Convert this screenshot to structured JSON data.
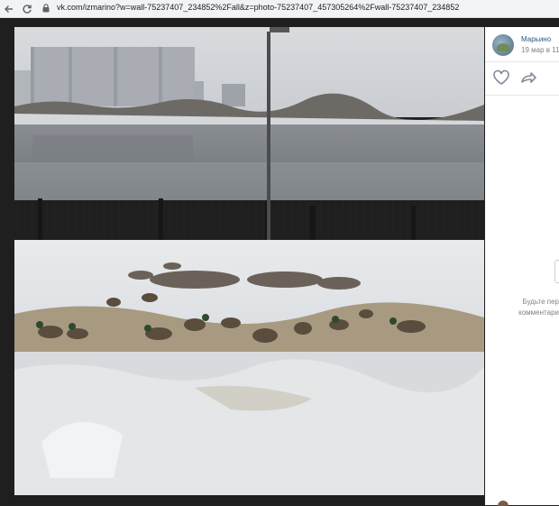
{
  "browser": {
    "url": "vk.com/izmarino?w=wall-75237407_234852%2Fall&z=photo-75237407_457305264%2Fwall-75237407_234852"
  },
  "post": {
    "author": "Марьино",
    "date": "19 мар в 11:"
  },
  "comments": {
    "hint_line1": "Будьте пер",
    "hint_line2": "комментари"
  },
  "icons": {
    "back": "arrow-left-icon",
    "reload": "reload-icon",
    "lock": "lock-icon",
    "like": "heart-icon",
    "share": "share-arrow-icon"
  },
  "colors": {
    "viewer_bg": "#1f1f1f",
    "link": "#2a5885",
    "muted": "#828282"
  }
}
